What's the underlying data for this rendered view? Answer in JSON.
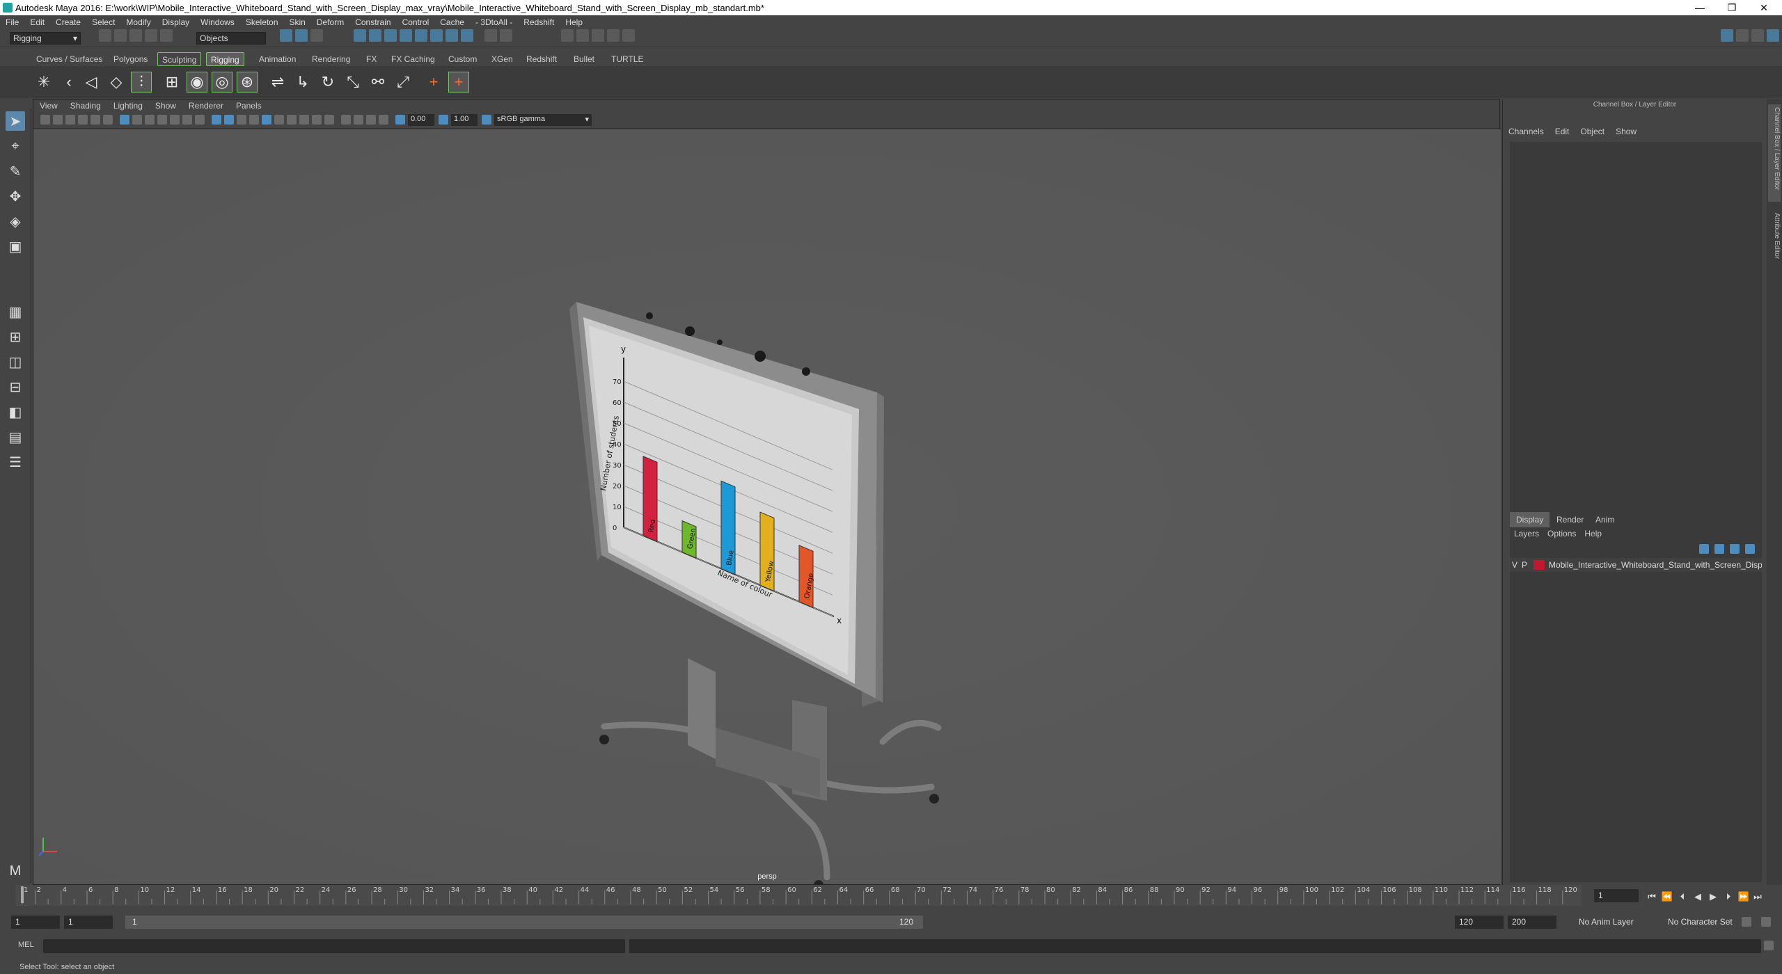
{
  "window": {
    "title": "Autodesk Maya 2016: E:\\work\\WIP\\Mobile_Interactive_Whiteboard_Stand_with_Screen_Display_max_vray\\Mobile_Interactive_Whiteboard_Stand_with_Screen_Display_mb_standart.mb*",
    "minimize": "—",
    "restore": "❐",
    "close": "✕"
  },
  "menubar": [
    "File",
    "Edit",
    "Create",
    "Select",
    "Modify",
    "Display",
    "Windows",
    "Skeleton",
    "Skin",
    "Deform",
    "Constrain",
    "Control",
    "Cache",
    "- 3DtoAll -",
    "Redshift",
    "Help"
  ],
  "statusline": {
    "menuset": "Rigging",
    "selection_mode": "Objects"
  },
  "shelf_tabs": [
    "Curves / Surfaces",
    "Polygons",
    "Sculpting",
    "Rigging",
    "Animation",
    "Rendering",
    "FX",
    "FX Caching",
    "Custom",
    "XGen",
    "Redshift",
    "Bullet",
    "TURTLE"
  ],
  "shelf_active_tab": "Rigging",
  "viewport": {
    "menu": [
      "View",
      "Shading",
      "Lighting",
      "Show",
      "Renderer",
      "Panels"
    ],
    "exposure": "0.00",
    "gamma": "1.00",
    "color_space": "sRGB gamma",
    "camera_label": "persp"
  },
  "scene": {
    "chart_y_axis_label": "Number of students",
    "chart_x_axis_label": "Name of colour",
    "chart_y_letter": "y",
    "chart_x_letter": "x",
    "chart_ticks": [
      "0",
      "10",
      "20",
      "30",
      "40",
      "50",
      "60",
      "70"
    ],
    "bars": [
      {
        "label": "Red",
        "value": 38,
        "color": "#d4213f"
      },
      {
        "label": "Green",
        "value": 15,
        "color": "#6fb82a"
      },
      {
        "label": "Blue",
        "value": 42,
        "color": "#1d9ad6"
      },
      {
        "label": "Yellow",
        "value": 35,
        "color": "#e2b01c"
      },
      {
        "label": "Orange",
        "value": 27,
        "color": "#e2572a"
      }
    ]
  },
  "channel_box": {
    "title": "Channel Box / Layer Editor",
    "menu": [
      "Channels",
      "Edit",
      "Object",
      "Show"
    ],
    "layer_tabs": [
      "Display",
      "Render",
      "Anim"
    ],
    "layer_active_tab": "Display",
    "layer_menu": [
      "Layers",
      "Options",
      "Help"
    ],
    "layer": {
      "v": "V",
      "p": "P",
      "color": "#c0182f",
      "name": "Mobile_Interactive_Whiteboard_Stand_with_Screen_Disp"
    },
    "side_tabs": [
      "Channel Box / Layer Editor",
      "Attribute Editor"
    ]
  },
  "timeslider": {
    "ticks": [
      "2",
      "4",
      "6",
      "8",
      "10",
      "12",
      "14",
      "16",
      "18",
      "20",
      "22",
      "24",
      "26",
      "28",
      "30",
      "32",
      "34",
      "36",
      "38",
      "40",
      "42",
      "44",
      "46",
      "48",
      "50",
      "52",
      "54",
      "56",
      "58",
      "60",
      "62",
      "64",
      "66",
      "68",
      "70",
      "72",
      "74",
      "76",
      "78",
      "80",
      "82",
      "84",
      "86",
      "88",
      "90",
      "92",
      "94",
      "96",
      "98",
      "100",
      "102",
      "104",
      "106",
      "108",
      "110",
      "112",
      "114",
      "116",
      "118",
      "120"
    ],
    "first_tick": "1",
    "current_frame": "1"
  },
  "range": {
    "start": "1",
    "playback_start": "1",
    "slider_start": "1",
    "slider_end": "120",
    "playback_end": "120",
    "end": "200",
    "anim_layer": "No Anim Layer",
    "char_set": "No Character Set"
  },
  "cmdline": {
    "label": "MEL"
  },
  "helpline": "Select Tool: select an object"
}
